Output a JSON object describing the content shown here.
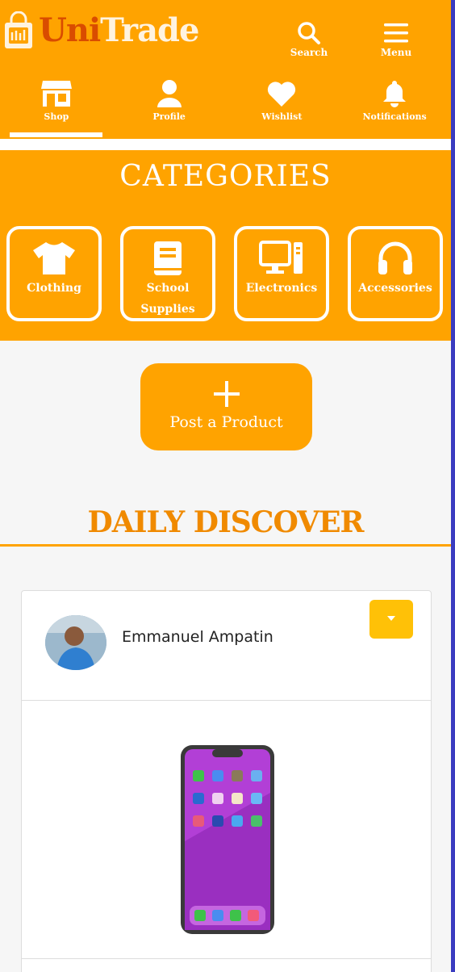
{
  "brand": {
    "name_part1": "Uni",
    "name_part2": "Trade"
  },
  "top_actions": {
    "search_label": "Search",
    "menu_label": "Menu"
  },
  "nav": {
    "items": [
      {
        "label": "Shop",
        "icon": "shop-icon"
      },
      {
        "label": "Profile",
        "icon": "user-icon"
      },
      {
        "label": "Wishlist",
        "icon": "heart-icon"
      },
      {
        "label": "Notifications",
        "icon": "bell-icon"
      }
    ],
    "active_index": 0
  },
  "categories": {
    "title": "CATEGORIES",
    "items": [
      {
        "label": "Clothing",
        "icon": "tshirt-icon"
      },
      {
        "label": "School Supplies",
        "icon": "book-icon"
      },
      {
        "label": "Electronics",
        "icon": "desktop-icon"
      },
      {
        "label": "Accessories",
        "icon": "headphones-icon"
      }
    ]
  },
  "post": {
    "label": "Post a Product",
    "icon": "plus-icon"
  },
  "daily_discover": {
    "title": "DAILY DISCOVER",
    "card": {
      "seller_name": "Emmanuel Ampatin",
      "icon": "caret-down-icon",
      "product_icon": "smartphone-image"
    }
  },
  "colors": {
    "primary": "#ffa300",
    "accent_title": "#f08a00",
    "dropdown": "#ffc107",
    "brand_dark": "#d94c00"
  }
}
